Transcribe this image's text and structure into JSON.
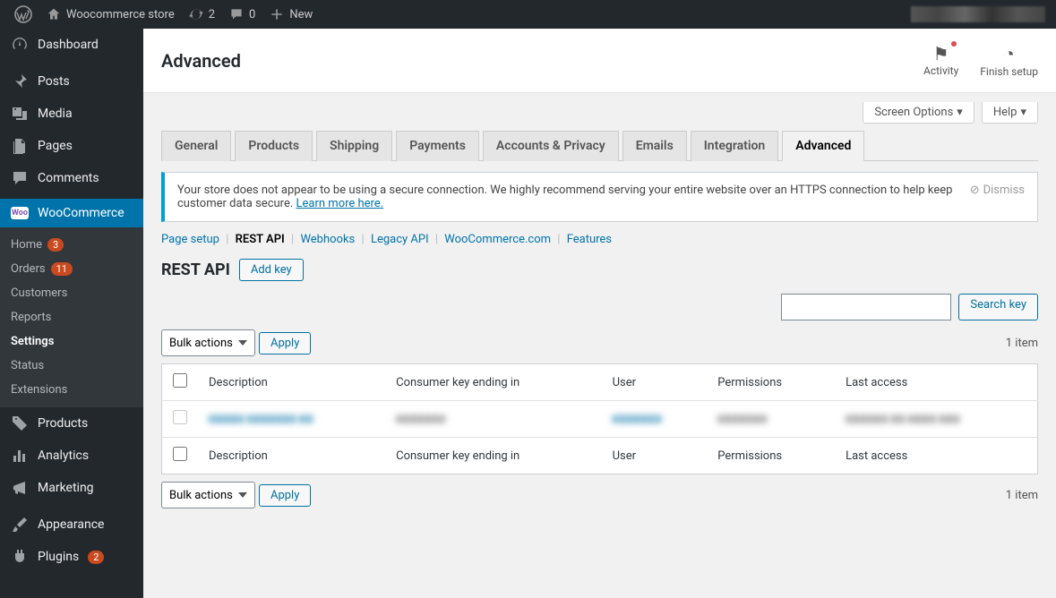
{
  "adminbar": {
    "site_name": "Woocommerce store",
    "updates_count": "2",
    "comments_count": "0",
    "new_label": "New"
  },
  "sidebar": {
    "dashboard": "Dashboard",
    "posts": "Posts",
    "media": "Media",
    "pages": "Pages",
    "comments": "Comments",
    "woocommerce": "WooCommerce",
    "wc_sub": {
      "home": "Home",
      "home_badge": "3",
      "orders": "Orders",
      "orders_badge": "11",
      "customers": "Customers",
      "reports": "Reports",
      "settings": "Settings",
      "status": "Status",
      "extensions": "Extensions"
    },
    "products": "Products",
    "analytics": "Analytics",
    "marketing": "Marketing",
    "appearance": "Appearance",
    "plugins": "Plugins",
    "plugins_badge": "2"
  },
  "header": {
    "title": "Advanced",
    "activity": "Activity",
    "finish_setup": "Finish setup"
  },
  "screen_meta": {
    "screen_options": "Screen Options",
    "help": "Help"
  },
  "tabs": {
    "general": "General",
    "products": "Products",
    "shipping": "Shipping",
    "payments": "Payments",
    "accounts": "Accounts & Privacy",
    "emails": "Emails",
    "integration": "Integration",
    "advanced": "Advanced"
  },
  "notice": {
    "text_a": "Your store does not appear to be using a secure connection. We highly recommend serving your entire website over an HTTPS connection to help keep customer data secure. ",
    "learn_more": "Learn more here.",
    "dismiss": "Dismiss"
  },
  "subtabs": {
    "page_setup": "Page setup",
    "rest_api": "REST API",
    "webhooks": "Webhooks",
    "legacy_api": "Legacy API",
    "wc_com": "WooCommerce.com",
    "features": "Features"
  },
  "page": {
    "heading": "REST API",
    "add_key": "Add key",
    "search_key": "Search key",
    "bulk_actions": "Bulk actions",
    "apply": "Apply",
    "item_count": "1 item"
  },
  "columns": {
    "description": "Description",
    "consumer_key": "Consumer key ending in",
    "user": "User",
    "permissions": "Permissions",
    "last_access": "Last access"
  },
  "rows": [
    {
      "description": "■■■■■ ■■■■■■■ ■■",
      "consumer_key": "■■■■■■■",
      "user": "■■■■■■■",
      "permissions": "■■■■■■■",
      "last_access": "■■■■■■ ■■ ■■■■ ■■■"
    }
  ]
}
